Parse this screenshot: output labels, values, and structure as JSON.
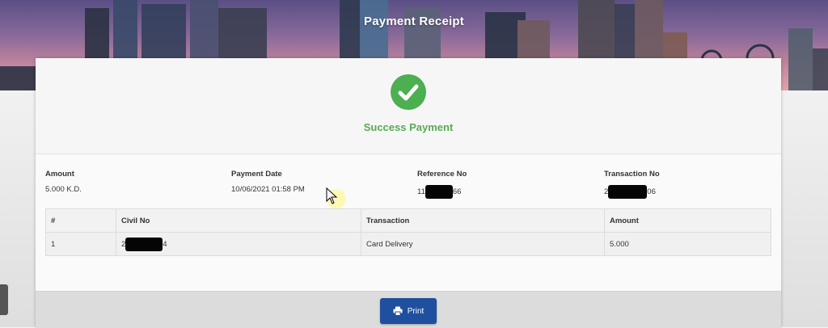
{
  "header": {
    "title": "Payment Receipt"
  },
  "status": {
    "title": "Success Payment",
    "color": "#4caf50"
  },
  "summary": {
    "amount": {
      "label": "Amount",
      "value": "5.000 K.D."
    },
    "payment_date": {
      "label": "Payment Date",
      "value": "10/06/2021 01:58 PM"
    },
    "reference_no": {
      "label": "Reference No",
      "prefix": "11",
      "suffix": "66"
    },
    "transaction_no": {
      "label": "Transaction No",
      "prefix": "2",
      "suffix": "06"
    }
  },
  "table": {
    "headers": [
      "#",
      "Civil No",
      "Transaction",
      "Amount"
    ],
    "rows": [
      {
        "index": "1",
        "civil_prefix": "2",
        "civil_suffix": "4",
        "transaction": "Card Delivery",
        "amount": "5.000"
      }
    ]
  },
  "actions": {
    "print_label": "Print"
  },
  "colors": {
    "accent": "#1f4f9e",
    "success": "#5aaa55"
  },
  "icons": {
    "status": "check-circle-icon",
    "print": "printer-icon"
  }
}
